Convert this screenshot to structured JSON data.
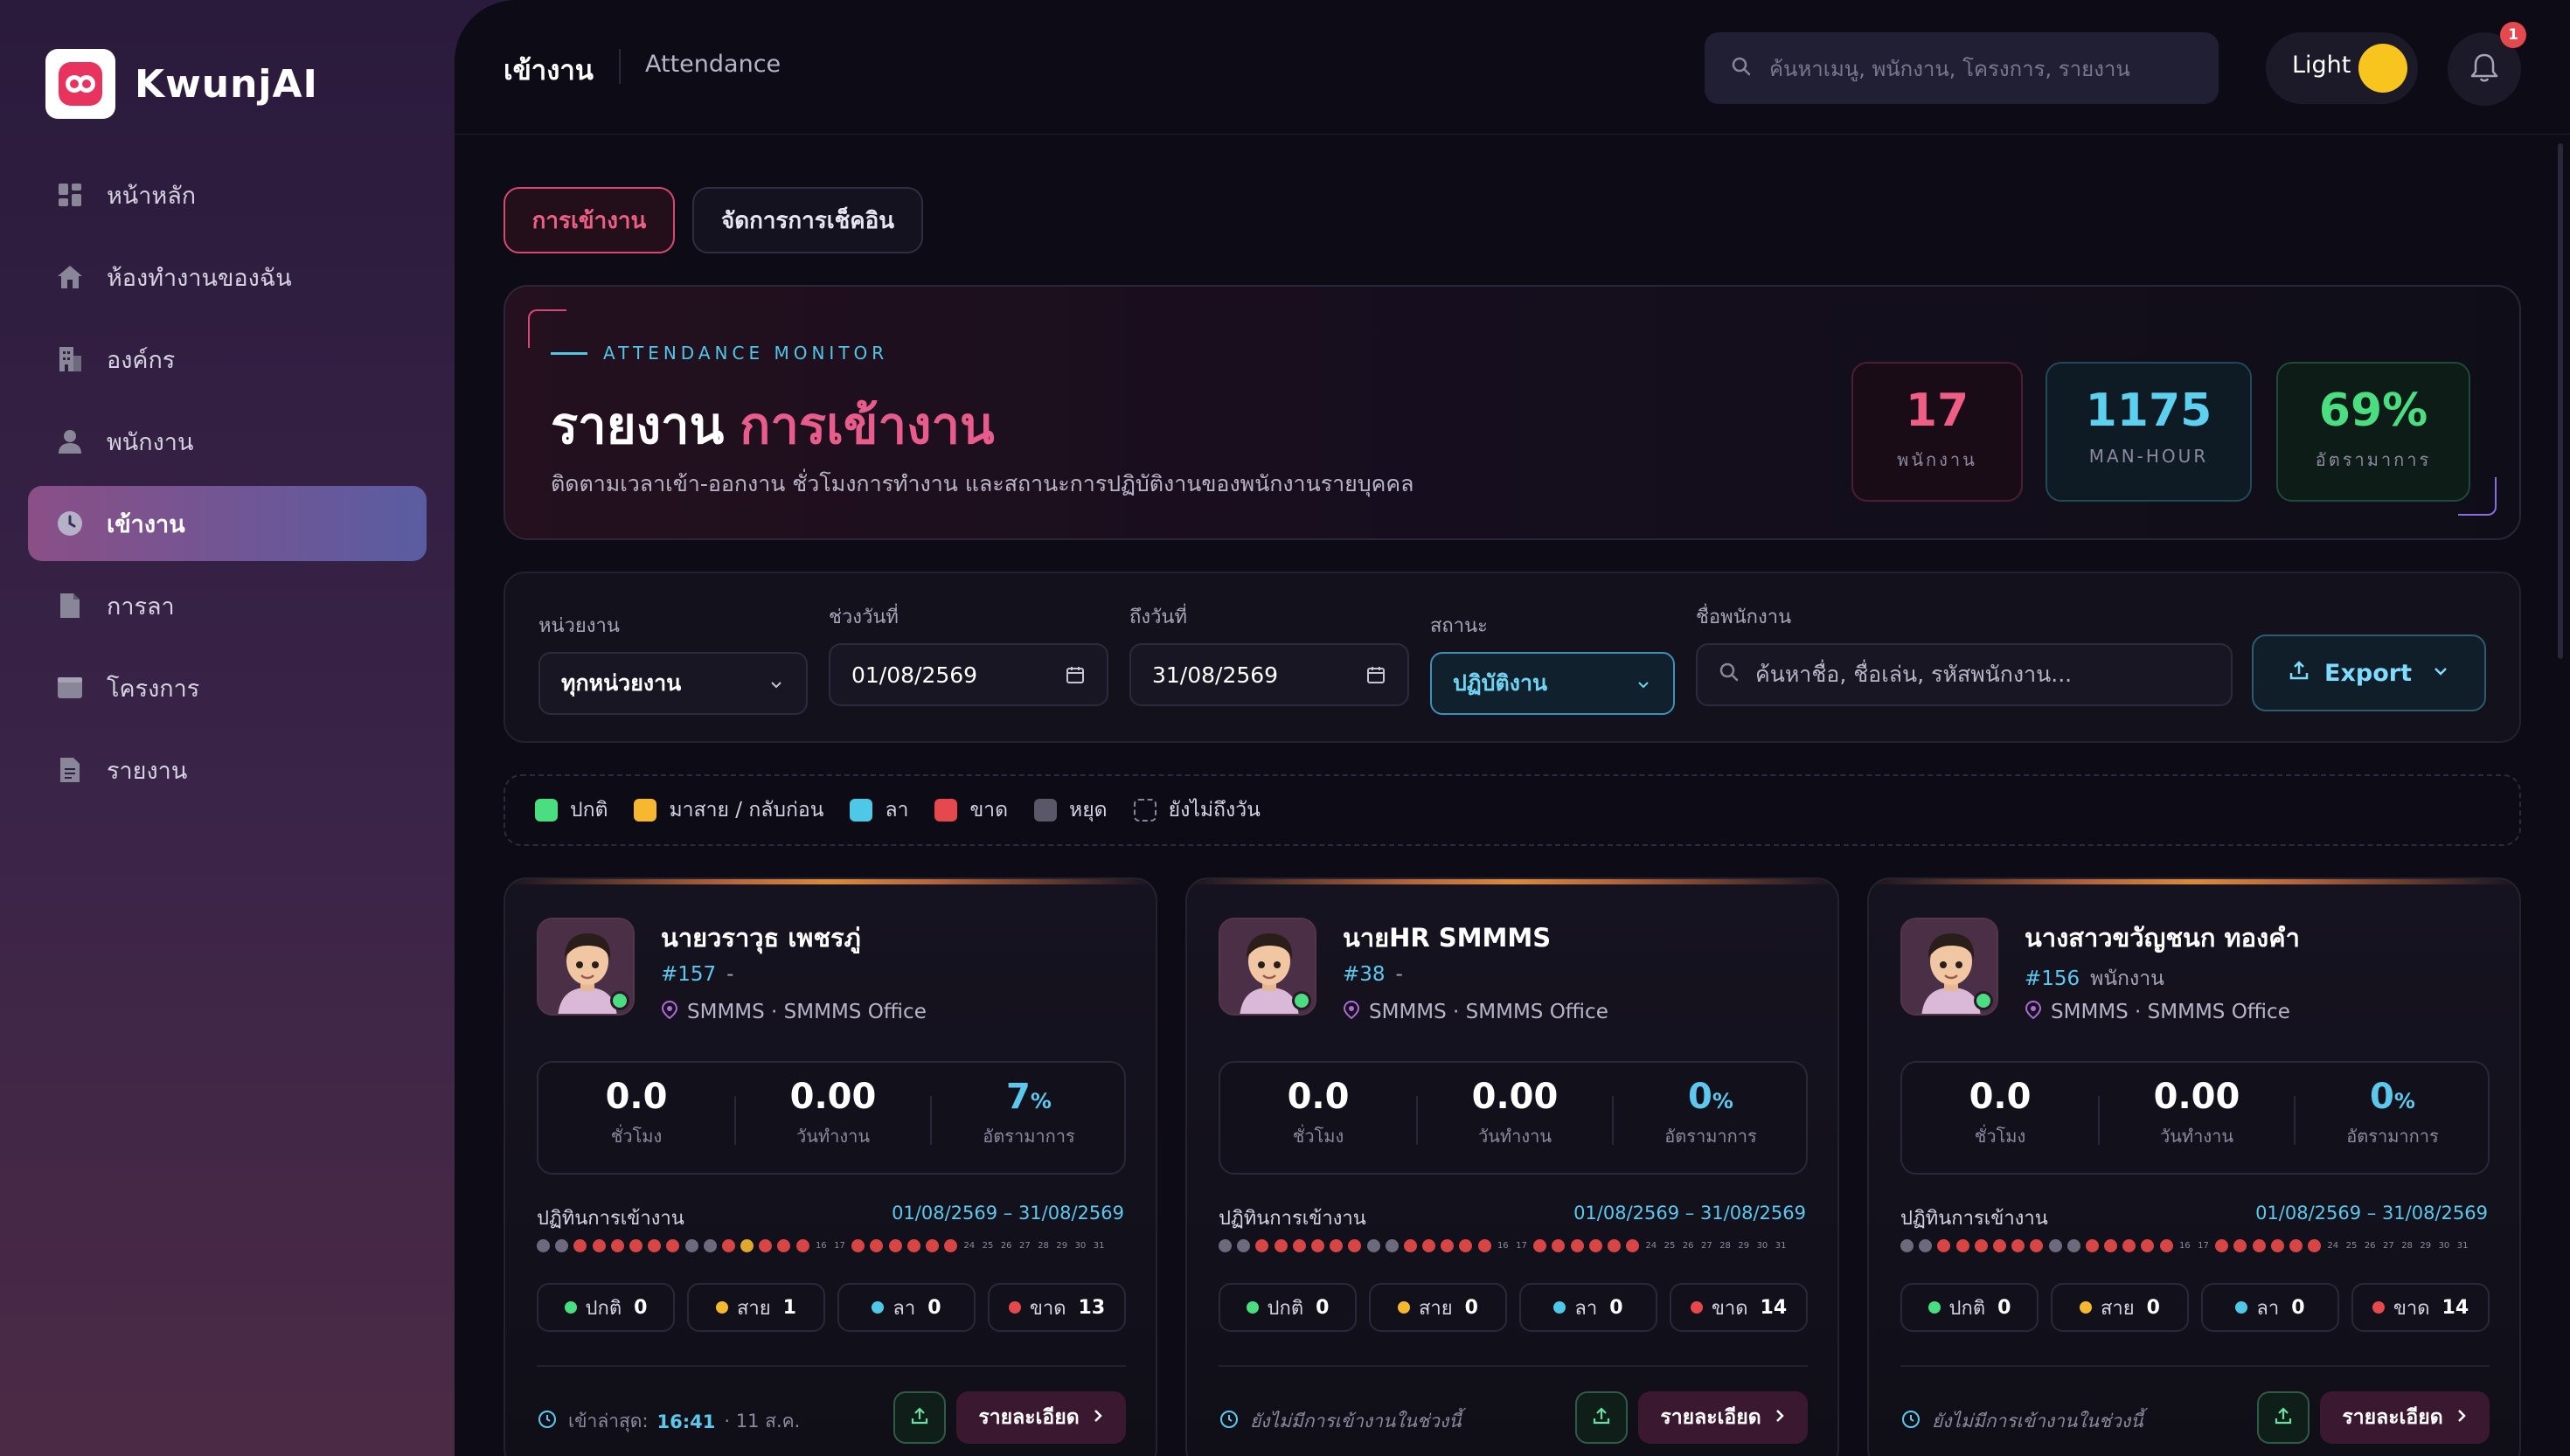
{
  "app": {
    "name": "KwunjAI"
  },
  "sidebar": {
    "items": [
      {
        "label": "หน้าหลัก",
        "icon": "dashboard-icon"
      },
      {
        "label": "ห้องทำงานของฉัน",
        "icon": "home-icon"
      },
      {
        "label": "องค์กร",
        "icon": "building-icon"
      },
      {
        "label": "พนักงาน",
        "icon": "user-icon"
      },
      {
        "label": "เข้างาน",
        "icon": "clock-icon",
        "active": true
      },
      {
        "label": "การลา",
        "icon": "document-icon"
      },
      {
        "label": "โครงการ",
        "icon": "folder-icon"
      },
      {
        "label": "รายงาน",
        "icon": "report-icon"
      }
    ]
  },
  "header": {
    "title": "เข้างาน",
    "subtitle": "Attendance",
    "search_placeholder": "ค้นหาเมนู, พนักงาน, โครงการ, รายงาน",
    "theme_label": "Light",
    "notification_count": "1"
  },
  "tabs": [
    {
      "label": "การเข้างาน",
      "active": true
    },
    {
      "label": "จัดการการเช็คอิน"
    }
  ],
  "hero": {
    "kicker": "ATTENDANCE MONITOR",
    "title_white": "รายงาน",
    "title_pink": "การเข้างาน",
    "description": "ติดตามเวลาเข้า-ออกงาน ชั่วโมงการทำงาน และสถานะการปฏิบัติงานของพนักงานรายบุคคล",
    "stats": [
      {
        "value": "17",
        "label": "พนักงาน"
      },
      {
        "value": "1175",
        "label": "MAN-HOUR"
      },
      {
        "value": "69%",
        "label": "อัตรามาการ"
      }
    ]
  },
  "filters": {
    "dept_label": "หน่วยงาน",
    "dept_value": "ทุกหน่วยงาน",
    "from_label": "ช่วงวันที่",
    "from_value": "01/08/2569",
    "to_label": "ถึงวันที่",
    "to_value": "31/08/2569",
    "status_label": "สถานะ",
    "status_value": "ปฏิบัติงาน",
    "name_label": "ชื่อพนักงาน",
    "name_placeholder": "ค้นหาชื่อ, ชื่อเล่น, รหัสพนักงาน...",
    "export_label": "Export"
  },
  "legend": [
    {
      "label": "ปกติ",
      "color": "#4ade80"
    },
    {
      "label": "มาสาย / กลับก่อน",
      "color": "#f5b82e"
    },
    {
      "label": "ลา",
      "color": "#4fc8e8"
    },
    {
      "label": "ขาด",
      "color": "#e5484d"
    },
    {
      "label": "หยุด",
      "color": "#5a5868"
    },
    {
      "label": "ยังไม่ถึงวัน",
      "color": "dashed"
    }
  ],
  "cards": [
    {
      "name": "นายวราวุธ เพชรภู่",
      "id": "#157",
      "role": "-",
      "location": "SMMMS · SMMMS Office",
      "hours": "0.0",
      "hours_label": "ชั่วโมง",
      "days": "0.00",
      "days_label": "วันทำงาน",
      "rate": "7",
      "rate_unit": "%",
      "rate_label": "อัตรามาการ",
      "att_label": "ปฏิทินการเข้างาน",
      "range": "01/08/2569 – 31/08/2569",
      "day_status": [
        "o",
        "o",
        "a",
        "a",
        "a",
        "a",
        "a",
        "a",
        "o",
        "o",
        "a",
        "y",
        "a",
        "a",
        "a",
        "f",
        "f",
        "a",
        "a",
        "a",
        "a",
        "a",
        "a",
        "f",
        "f",
        "f",
        "f",
        "f",
        "f",
        "f",
        "f"
      ],
      "pills": [
        {
          "label": "ปกติ",
          "count": "0",
          "color": "#4ade80"
        },
        {
          "label": "สาย",
          "count": "1",
          "color": "#f5b82e"
        },
        {
          "label": "ลา",
          "count": "0",
          "color": "#4fc8e8"
        },
        {
          "label": "ขาด",
          "count": "13",
          "color": "#e5484d"
        }
      ],
      "last_label": "เข้าล่าสุด:",
      "last_time": "16:41",
      "last_date": "· 11 ส.ค.",
      "no_attendance": false,
      "details_label": "รายละเอียด"
    },
    {
      "name": "นายHR SMMMS",
      "id": "#38",
      "role": "-",
      "location": "SMMMS · SMMMS Office",
      "hours": "0.0",
      "hours_label": "ชั่วโมง",
      "days": "0.00",
      "days_label": "วันทำงาน",
      "rate": "0",
      "rate_unit": "%",
      "rate_label": "อัตรามาการ",
      "att_label": "ปฏิทินการเข้างาน",
      "range": "01/08/2569 – 31/08/2569",
      "day_status": [
        "o",
        "o",
        "a",
        "a",
        "a",
        "a",
        "a",
        "a",
        "o",
        "o",
        "a",
        "a",
        "a",
        "a",
        "a",
        "f",
        "f",
        "a",
        "a",
        "a",
        "a",
        "a",
        "a",
        "f",
        "f",
        "f",
        "f",
        "f",
        "f",
        "f",
        "f"
      ],
      "pills": [
        {
          "label": "ปกติ",
          "count": "0",
          "color": "#4ade80"
        },
        {
          "label": "สาย",
          "count": "0",
          "color": "#f5b82e"
        },
        {
          "label": "ลา",
          "count": "0",
          "color": "#4fc8e8"
        },
        {
          "label": "ขาด",
          "count": "14",
          "color": "#e5484d"
        }
      ],
      "no_attendance": true,
      "no_attendance_label": "ยังไม่มีการเข้างานในช่วงนี้",
      "details_label": "รายละเอียด"
    },
    {
      "name": "นางสาวขวัญชนก ทองคำ",
      "id": "#156",
      "role": "พนักงาน",
      "location": "SMMMS · SMMMS Office",
      "hours": "0.0",
      "hours_label": "ชั่วโมง",
      "days": "0.00",
      "days_label": "วันทำงาน",
      "rate": "0",
      "rate_unit": "%",
      "rate_label": "อัตรามาการ",
      "att_label": "ปฏิทินการเข้างาน",
      "range": "01/08/2569 – 31/08/2569",
      "day_status": [
        "o",
        "o",
        "a",
        "a",
        "a",
        "a",
        "a",
        "a",
        "o",
        "o",
        "a",
        "a",
        "a",
        "a",
        "a",
        "f",
        "f",
        "a",
        "a",
        "a",
        "a",
        "a",
        "a",
        "f",
        "f",
        "f",
        "f",
        "f",
        "f",
        "f",
        "f"
      ],
      "pills": [
        {
          "label": "ปกติ",
          "count": "0",
          "color": "#4ade80"
        },
        {
          "label": "สาย",
          "count": "0",
          "color": "#f5b82e"
        },
        {
          "label": "ลา",
          "count": "0",
          "color": "#4fc8e8"
        },
        {
          "label": "ขาด",
          "count": "14",
          "color": "#e5484d"
        }
      ],
      "no_attendance": true,
      "no_attendance_label": "ยังไม่มีการเข้างานในช่วงนี้",
      "details_label": "รายละเอียด"
    }
  ]
}
